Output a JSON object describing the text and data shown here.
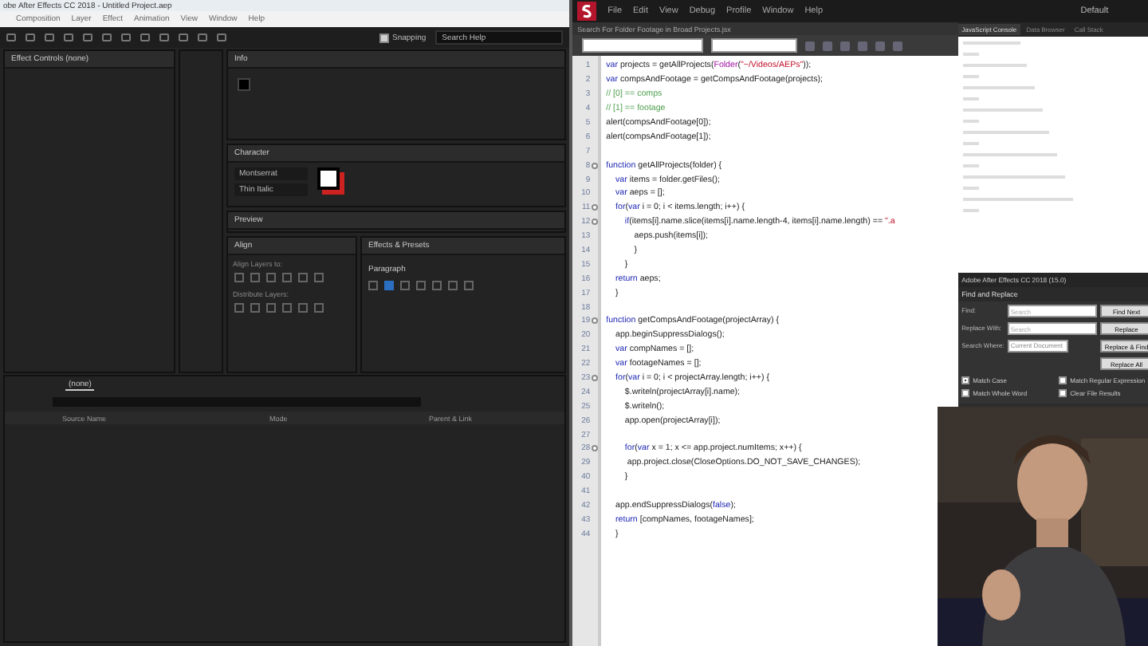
{
  "ae": {
    "title": "obe After Effects CC 2018 - Untitled Project.aep",
    "menu": [
      "Composition",
      "Layer",
      "Effect",
      "Animation",
      "View",
      "Window",
      "Help"
    ],
    "snapping": {
      "label": "Snapping",
      "checked": true
    },
    "search": {
      "placeholder": "Search Help"
    },
    "left_panel": {
      "title": "Effect Controls (none)"
    },
    "info": {
      "title": "Info"
    },
    "character": {
      "title": "Character",
      "font": "Montserrat",
      "style": "Thin Italic"
    },
    "preview": {
      "title": "Preview"
    },
    "align": {
      "title": "Align",
      "label_1": "Align Layers to:",
      "label_2": "Distribute Layers:"
    },
    "effects": {
      "title": "Effects & Presets"
    },
    "paragraph": {
      "title": "Paragraph"
    },
    "timeline": {
      "tab": "(none)",
      "columns": [
        "Source Name",
        "Mode",
        "Parent & Link"
      ]
    }
  },
  "estk": {
    "menu": [
      "File",
      "Edit",
      "View",
      "Debug",
      "Profile",
      "Window",
      "Help"
    ],
    "workspace": "Default",
    "doc_tab": "Search For Folder Footage in Broad Projects.jsx",
    "lines": [
      {
        "n": "1",
        "fold": false,
        "segs": [
          {
            "t": "var",
            "kind": "keyword"
          },
          {
            "t": " projects = getAllProjects("
          },
          {
            "t": "Folder",
            "kind": "builtin"
          },
          {
            "t": "("
          },
          {
            "t": "\"~/Videos/AEPs\"",
            "kind": "string"
          },
          {
            "t": "));"
          }
        ]
      },
      {
        "n": "2",
        "fold": false,
        "segs": [
          {
            "t": "var",
            "kind": "keyword"
          },
          {
            "t": " compsAndFootage = getCompsAndFootage(projects);"
          }
        ]
      },
      {
        "n": "3",
        "fold": false,
        "segs": [
          {
            "t": "// [0] == comps",
            "kind": "comment"
          }
        ]
      },
      {
        "n": "4",
        "fold": false,
        "segs": [
          {
            "t": "// [1] == footage",
            "kind": "comment"
          }
        ]
      },
      {
        "n": "5",
        "fold": false,
        "segs": [
          {
            "t": "alert(compsAndFootage[0]);"
          }
        ]
      },
      {
        "n": "6",
        "fold": false,
        "segs": [
          {
            "t": "alert(compsAndFootage[1]);"
          }
        ]
      },
      {
        "n": "7",
        "fold": false
      },
      {
        "n": "8",
        "fold": true,
        "segs": [
          {
            "t": "function",
            "kind": "keyword"
          },
          {
            "t": " getAllProjects(folder) {"
          }
        ]
      },
      {
        "n": "9",
        "fold": false,
        "segs": [
          {
            "t": "    var",
            "kind": "keyword"
          },
          {
            "t": " items = folder.getFiles();"
          }
        ]
      },
      {
        "n": "10",
        "fold": false,
        "segs": [
          {
            "t": "    var",
            "kind": "keyword"
          },
          {
            "t": " aeps = [];"
          }
        ]
      },
      {
        "n": "11",
        "fold": true,
        "segs": [
          {
            "t": "    for",
            "kind": "keyword"
          },
          {
            "t": "("
          },
          {
            "t": "var",
            "kind": "keyword"
          },
          {
            "t": " i = 0; i < items.length; i++) {"
          }
        ]
      },
      {
        "n": "12",
        "fold": true,
        "segs": [
          {
            "t": "        if",
            "kind": "keyword"
          },
          {
            "t": "(items[i].name.slice(items[i].name.length-4, items[i].name.length) == "
          },
          {
            "t": "\".a",
            "kind": "string"
          }
        ]
      },
      {
        "n": "13",
        "fold": false,
        "segs": [
          {
            "t": "            aeps.push(items[i]);"
          }
        ]
      },
      {
        "n": "14",
        "fold": false,
        "segs": [
          {
            "t": "            }"
          }
        ]
      },
      {
        "n": "15",
        "fold": false,
        "segs": [
          {
            "t": "        }"
          }
        ]
      },
      {
        "n": "16",
        "fold": false,
        "segs": [
          {
            "t": "    return",
            "kind": "keyword"
          },
          {
            "t": " aeps;"
          }
        ]
      },
      {
        "n": "17",
        "fold": false,
        "segs": [
          {
            "t": "    }"
          }
        ]
      },
      {
        "n": "18",
        "fold": false
      },
      {
        "n": "19",
        "fold": true,
        "segs": [
          {
            "t": "function",
            "kind": "keyword"
          },
          {
            "t": " getCompsAndFootage(projectArray) {"
          }
        ]
      },
      {
        "n": "20",
        "fold": false,
        "segs": [
          {
            "t": "    app.beginSuppressDialogs();"
          }
        ]
      },
      {
        "n": "21",
        "fold": false,
        "segs": [
          {
            "t": "    var",
            "kind": "keyword"
          },
          {
            "t": " compNames = [];"
          }
        ]
      },
      {
        "n": "22",
        "fold": false,
        "segs": [
          {
            "t": "    var",
            "kind": "keyword"
          },
          {
            "t": " footageNames = [];"
          }
        ]
      },
      {
        "n": "23",
        "fold": true,
        "segs": [
          {
            "t": "    for",
            "kind": "keyword"
          },
          {
            "t": "("
          },
          {
            "t": "var",
            "kind": "keyword"
          },
          {
            "t": " i = 0; i < projectArray.length; i++) {"
          }
        ]
      },
      {
        "n": "24",
        "fold": false,
        "segs": [
          {
            "t": "        $.writeln(projectArray[i].name);"
          }
        ]
      },
      {
        "n": "25",
        "fold": false,
        "segs": [
          {
            "t": "        $.writeln();"
          }
        ]
      },
      {
        "n": "26",
        "fold": false,
        "segs": [
          {
            "t": "        app.open(projectArray[i]);"
          }
        ]
      },
      {
        "n": "27",
        "fold": false
      },
      {
        "n": "28",
        "fold": true,
        "segs": [
          {
            "t": "        for",
            "kind": "keyword"
          },
          {
            "t": "("
          },
          {
            "t": "var",
            "kind": "keyword"
          },
          {
            "t": " x = 1; x <= app.project.numItems; x++) {"
          }
        ]
      },
      {
        "n": "29",
        "fold": false,
        "segs": [
          {
            "t": "         app.project.close(CloseOptions.DO_NOT_SAVE_CHANGES);"
          }
        ]
      },
      {
        "n": "40",
        "fold": false,
        "segs": [
          {
            "t": "        }"
          }
        ]
      },
      {
        "n": "41",
        "fold": false
      },
      {
        "n": "42",
        "fold": false,
        "segs": [
          {
            "t": "    app.endSuppressDialogs("
          },
          {
            "t": "false",
            "kind": "keyword"
          },
          {
            "t": ");"
          }
        ]
      },
      {
        "n": "43",
        "fold": false,
        "segs": [
          {
            "t": "    return",
            "kind": "keyword"
          },
          {
            "t": " [compNames, footageNames];"
          }
        ]
      },
      {
        "n": "44",
        "fold": false,
        "segs": [
          {
            "t": "    }"
          }
        ]
      }
    ],
    "console": {
      "tabs": [
        {
          "label": "JavaScript Console",
          "selected": true
        },
        {
          "label": "Data Browser",
          "selected": false
        },
        {
          "label": "Call Stack",
          "selected": false
        }
      ]
    },
    "target": "Adobe After Effects CC 2018 (15.0)",
    "find": {
      "title": "Find and Replace",
      "fields": [
        {
          "label": "Find:",
          "kind": "input",
          "placeholder": "Search"
        },
        {
          "label": "Replace With:",
          "kind": "input",
          "placeholder": "Search"
        },
        {
          "label": "Search Where:",
          "kind": "select",
          "value": "Current Document"
        }
      ],
      "buttons": [
        "Find Next",
        "Replace",
        "Replace & Find",
        "Replace All"
      ],
      "options": [
        {
          "label": "Match Case",
          "checked": true
        },
        {
          "label": "Match Regular Expression",
          "checked": false
        },
        {
          "label": "Match Whole Word",
          "checked": false
        },
        {
          "label": "Clear File Results",
          "checked": false
        }
      ]
    }
  }
}
